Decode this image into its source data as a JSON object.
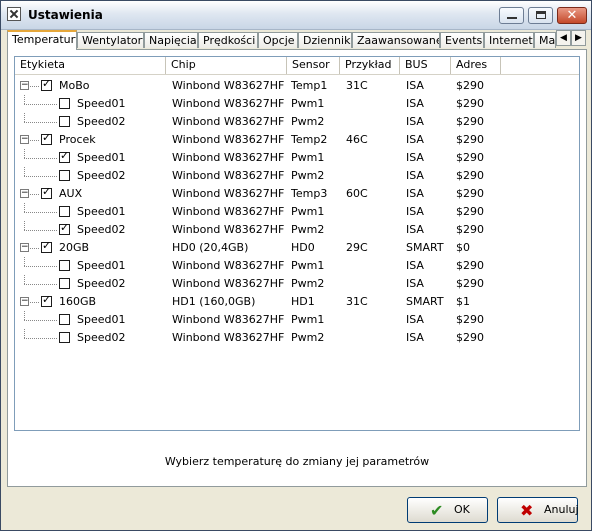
{
  "window": {
    "title": "Ustawienia"
  },
  "tabs": [
    {
      "label": "Temperatury"
    },
    {
      "label": "Wentylatory"
    },
    {
      "label": "Napięcia"
    },
    {
      "label": "Prędkości"
    },
    {
      "label": "Opcje"
    },
    {
      "label": "Dziennik"
    },
    {
      "label": "Zaawansowane"
    },
    {
      "label": "Events"
    },
    {
      "label": "Internet"
    },
    {
      "label": "Ma"
    }
  ],
  "table": {
    "columns": [
      "Etykieta",
      "Chip",
      "Sensor",
      "Przykład",
      "BUS",
      "Adres"
    ],
    "rows": [
      {
        "level": 0,
        "checked": true,
        "label": "MoBo",
        "chip": "Winbond W83627HF",
        "sensor": "Temp1",
        "example": "31C",
        "bus": "ISA",
        "address": "$290"
      },
      {
        "level": 1,
        "checked": false,
        "label": "Speed01",
        "chip": "Winbond W83627HF",
        "sensor": "Pwm1",
        "example": "",
        "bus": "ISA",
        "address": "$290"
      },
      {
        "level": 1,
        "checked": false,
        "label": "Speed02",
        "chip": "Winbond W83627HF",
        "sensor": "Pwm2",
        "example": "",
        "bus": "ISA",
        "address": "$290"
      },
      {
        "level": 0,
        "checked": true,
        "label": "Procek",
        "chip": "Winbond W83627HF",
        "sensor": "Temp2",
        "example": "46C",
        "bus": "ISA",
        "address": "$290"
      },
      {
        "level": 1,
        "checked": true,
        "label": "Speed01",
        "chip": "Winbond W83627HF",
        "sensor": "Pwm1",
        "example": "",
        "bus": "ISA",
        "address": "$290"
      },
      {
        "level": 1,
        "checked": false,
        "label": "Speed02",
        "chip": "Winbond W83627HF",
        "sensor": "Pwm2",
        "example": "",
        "bus": "ISA",
        "address": "$290"
      },
      {
        "level": 0,
        "checked": true,
        "label": "AUX",
        "chip": "Winbond W83627HF",
        "sensor": "Temp3",
        "example": "60C",
        "bus": "ISA",
        "address": "$290"
      },
      {
        "level": 1,
        "checked": false,
        "label": "Speed01",
        "chip": "Winbond W83627HF",
        "sensor": "Pwm1",
        "example": "",
        "bus": "ISA",
        "address": "$290"
      },
      {
        "level": 1,
        "checked": true,
        "label": "Speed02",
        "chip": "Winbond W83627HF",
        "sensor": "Pwm2",
        "example": "",
        "bus": "ISA",
        "address": "$290"
      },
      {
        "level": 0,
        "checked": true,
        "label": "20GB",
        "chip": "HD0 (20,4GB)",
        "sensor": "HD0",
        "example": "29C",
        "bus": "SMART",
        "address": "$0"
      },
      {
        "level": 1,
        "checked": false,
        "label": "Speed01",
        "chip": "Winbond W83627HF",
        "sensor": "Pwm1",
        "example": "",
        "bus": "ISA",
        "address": "$290"
      },
      {
        "level": 1,
        "checked": false,
        "label": "Speed02",
        "chip": "Winbond W83627HF",
        "sensor": "Pwm2",
        "example": "",
        "bus": "ISA",
        "address": "$290"
      },
      {
        "level": 0,
        "checked": true,
        "label": "160GB",
        "chip": "HD1 (160,0GB)",
        "sensor": "HD1",
        "example": "31C",
        "bus": "SMART",
        "address": "$1"
      },
      {
        "level": 1,
        "checked": false,
        "label": "Speed01",
        "chip": "Winbond W83627HF",
        "sensor": "Pwm1",
        "example": "",
        "bus": "ISA",
        "address": "$290"
      },
      {
        "level": 1,
        "checked": false,
        "label": "Speed02",
        "chip": "Winbond W83627HF",
        "sensor": "Pwm2",
        "example": "",
        "bus": "ISA",
        "address": "$290"
      }
    ]
  },
  "status": "Wybierz temperaturę do zmiany jej parametrów",
  "buttons": {
    "ok_label": "OK",
    "cancel_label": "Anuluj"
  },
  "colors": {
    "ok_icon": "#2d8b22",
    "cancel_icon": "#c00000",
    "active_tab_accent": "#e6a73a"
  }
}
